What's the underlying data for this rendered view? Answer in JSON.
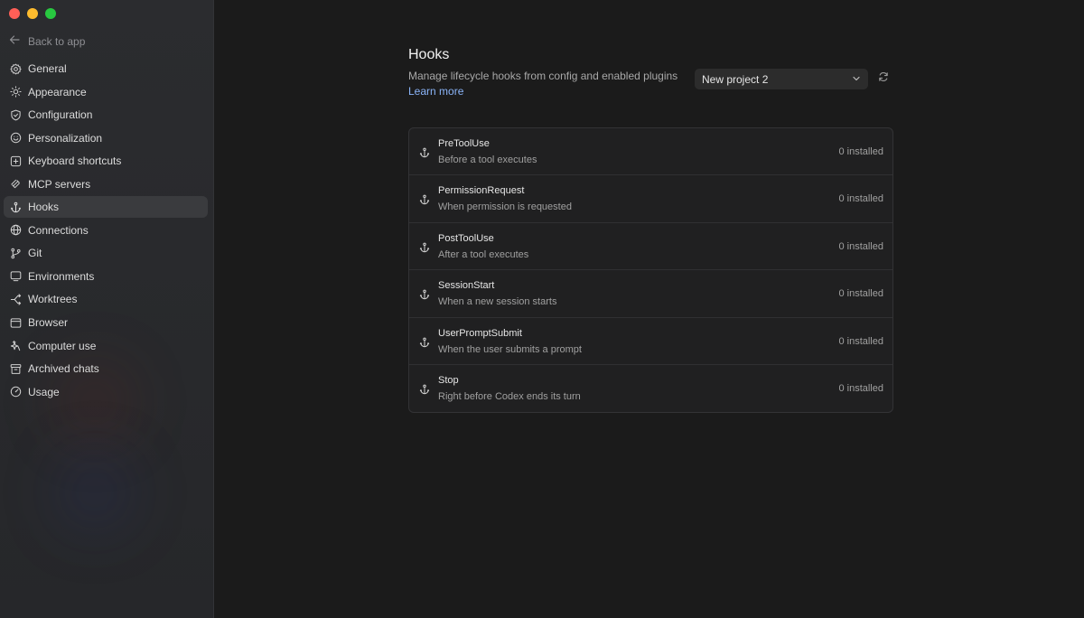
{
  "window": {
    "traffic_lights": [
      {
        "name": "close",
        "color": "#ff5f57"
      },
      {
        "name": "minimize",
        "color": "#febc2e"
      },
      {
        "name": "zoom",
        "color": "#28c840"
      }
    ]
  },
  "sidebar": {
    "back_label": "Back to app",
    "items": [
      {
        "label": "General",
        "icon": "gear-icon"
      },
      {
        "label": "Appearance",
        "icon": "sun-icon"
      },
      {
        "label": "Configuration",
        "icon": "shield-icon"
      },
      {
        "label": "Personalization",
        "icon": "smiley-icon"
      },
      {
        "label": "Keyboard shortcuts",
        "icon": "keyboard-icon"
      },
      {
        "label": "MCP servers",
        "icon": "mcp-icon"
      },
      {
        "label": "Hooks",
        "icon": "anchor-icon",
        "active": true
      },
      {
        "label": "Connections",
        "icon": "globe-icon"
      },
      {
        "label": "Git",
        "icon": "git-branch-icon"
      },
      {
        "label": "Environments",
        "icon": "monitor-icon"
      },
      {
        "label": "Worktrees",
        "icon": "worktree-icon"
      },
      {
        "label": "Browser",
        "icon": "browser-icon"
      },
      {
        "label": "Computer use",
        "icon": "sparkle-icon"
      },
      {
        "label": "Archived chats",
        "icon": "archive-icon"
      },
      {
        "label": "Usage",
        "icon": "gauge-icon"
      }
    ]
  },
  "main": {
    "title": "Hooks",
    "description": "Manage lifecycle hooks from config and enabled plugins",
    "learn_more": "Learn more",
    "project_select": {
      "value": "New project 2"
    },
    "hooks": [
      {
        "name": "PreToolUse",
        "description": "Before a tool executes",
        "count": "0 installed"
      },
      {
        "name": "PermissionRequest",
        "description": "When permission is requested",
        "count": "0 installed"
      },
      {
        "name": "PostToolUse",
        "description": "After a tool executes",
        "count": "0 installed"
      },
      {
        "name": "SessionStart",
        "description": "When a new session starts",
        "count": "0 installed"
      },
      {
        "name": "UserPromptSubmit",
        "description": "When the user submits a prompt",
        "count": "0 installed"
      },
      {
        "name": "Stop",
        "description": "Right before Codex ends its turn",
        "count": "0 installed"
      }
    ]
  }
}
